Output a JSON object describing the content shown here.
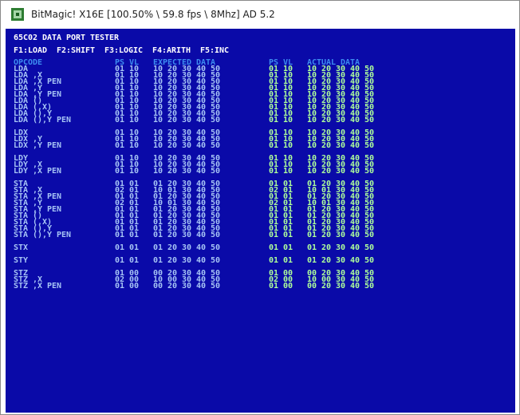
{
  "window": {
    "title": "BitMagic! X16E [100.50% \\ 59.8 fps \\ 8Mhz] AD 5.2"
  },
  "screen": {
    "title": "65C02 DATA PORT TESTER",
    "menu": "F1:LOAD  F2:SHIFT  F3:LOGIC  F4:ARITH  F5:INC",
    "headers": {
      "opcode": "OPCODE",
      "expected": "PS VL   EXPECTED DATA",
      "actual": "PS VL   ACTUAL DATA"
    },
    "rows": [
      {
        "label": "LDA",
        "expected": "01 10   10 20 30 40 50",
        "actual": "01 10   10 20 30 40 50"
      },
      {
        "label": "LDA ,X",
        "expected": "01 10   10 20 30 40 50",
        "actual": "01 10   10 20 30 40 50"
      },
      {
        "label": "LDA ,X PEN",
        "expected": "01 10   10 20 30 40 50",
        "actual": "01 10   10 20 30 40 50"
      },
      {
        "label": "LDA ,Y",
        "expected": "01 10   10 20 30 40 50",
        "actual": "01 10   10 20 30 40 50"
      },
      {
        "label": "LDA ,Y PEN",
        "expected": "01 10   10 20 30 40 50",
        "actual": "01 10   10 20 30 40 50"
      },
      {
        "label": "LDA ()",
        "expected": "01 10   10 20 30 40 50",
        "actual": "01 10   10 20 30 40 50"
      },
      {
        "label": "LDA (,X)",
        "expected": "01 10   10 20 30 40 50",
        "actual": "01 10   10 20 30 40 50"
      },
      {
        "label": "LDA (),Y",
        "expected": "01 10   10 20 30 40 50",
        "actual": "01 10   10 20 30 40 50"
      },
      {
        "label": "LDA (),Y PEN",
        "expected": "01 10   10 20 30 40 50",
        "actual": "01 10   10 20 30 40 50"
      },
      {
        "label": "LDX",
        "expected": "01 10   10 20 30 40 50",
        "actual": "01 10   10 20 30 40 50"
      },
      {
        "label": "LDX ,Y",
        "expected": "01 10   10 20 30 40 50",
        "actual": "01 10   10 20 30 40 50"
      },
      {
        "label": "LDX ,Y PEN",
        "expected": "01 10   10 20 30 40 50",
        "actual": "01 10   10 20 30 40 50"
      },
      {
        "label": "LDY",
        "expected": "01 10   10 20 30 40 50",
        "actual": "01 10   10 20 30 40 50"
      },
      {
        "label": "LDY ,X",
        "expected": "01 10   10 20 30 40 50",
        "actual": "01 10   10 20 30 40 50"
      },
      {
        "label": "LDY ,X PEN",
        "expected": "01 10   10 20 30 40 50",
        "actual": "01 10   10 20 30 40 50"
      },
      {
        "label": "STA",
        "expected": "01 01   01 20 30 40 50",
        "actual": "01 01   01 20 30 40 50"
      },
      {
        "label": "STA ,X",
        "expected": "02 01   10 01 30 40 50",
        "actual": "02 01   10 01 30 40 50"
      },
      {
        "label": "STA ,X PEN",
        "expected": "01 01   01 20 30 40 50",
        "actual": "01 01   01 20 30 40 50"
      },
      {
        "label": "STA ,Y",
        "expected": "02 01   10 01 30 40 50",
        "actual": "02 01   10 01 30 40 50"
      },
      {
        "label": "STA ,Y PEN",
        "expected": "01 01   01 20 30 40 50",
        "actual": "01 01   01 20 30 40 50"
      },
      {
        "label": "STA ()",
        "expected": "01 01   01 20 30 40 50",
        "actual": "01 01   01 20 30 40 50"
      },
      {
        "label": "STA (,X)",
        "expected": "01 01   01 20 30 40 50",
        "actual": "01 01   01 20 30 40 50"
      },
      {
        "label": "STA (),Y",
        "expected": "01 01   01 20 30 40 50",
        "actual": "01 01   01 20 30 40 50"
      },
      {
        "label": "STA (),Y PEN",
        "expected": "01 01   01 20 30 40 50",
        "actual": "01 01   01 20 30 40 50"
      },
      {
        "label": "STX",
        "expected": "01 01   01 20 30 40 50",
        "actual": "01 01   01 20 30 40 50"
      },
      {
        "label": "STY",
        "expected": "01 01   01 20 30 40 50",
        "actual": "01 01   01 20 30 40 50"
      },
      {
        "label": "STZ",
        "expected": "01 00   00 20 30 40 50",
        "actual": "01 00   00 20 30 40 50"
      },
      {
        "label": "STZ ,X",
        "expected": "02 00   10 00 30 40 50",
        "actual": "02 00   10 00 30 40 50"
      },
      {
        "label": "STZ ,X PEN",
        "expected": "01 00   00 20 30 40 50",
        "actual": "01 00   00 20 30 40 50"
      }
    ]
  },
  "colors": {
    "screen_bg": "#0a0aa8",
    "heading": "#ffffff",
    "column_header": "#3d8cf0",
    "expected_text": "#a6c4f5",
    "actual_text": "#aeff9b"
  },
  "icons": {
    "app": "bitmagic-app-icon"
  }
}
